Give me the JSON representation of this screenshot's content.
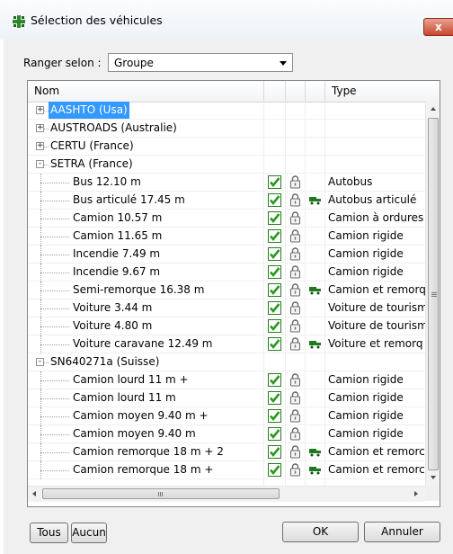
{
  "window": {
    "title": "Sélection des véhicules",
    "close_glyph": "x"
  },
  "sort": {
    "label": "Ranger selon :",
    "value": "Groupe"
  },
  "columns": {
    "name": "Nom",
    "type": "Type"
  },
  "rows": [
    {
      "level": 0,
      "expander": "+",
      "name": "AASHTO (Usa)",
      "selected": true
    },
    {
      "level": 0,
      "expander": "+",
      "name": "AUSTROADS (Australie)"
    },
    {
      "level": 0,
      "expander": "+",
      "name": "CERTU (France)"
    },
    {
      "level": 0,
      "expander": "-",
      "name": "SETRA (France)"
    },
    {
      "level": 1,
      "name": "Bus 12.10 m",
      "check": true,
      "lock": true,
      "trailer": false,
      "type": "Autobus"
    },
    {
      "level": 1,
      "name": "Bus articulé 17.45 m",
      "check": true,
      "lock": true,
      "trailer": true,
      "type": "Autobus articulé"
    },
    {
      "level": 1,
      "name": "Camion 10.57 m",
      "check": true,
      "lock": true,
      "trailer": false,
      "type": "Camion à ordures"
    },
    {
      "level": 1,
      "name": "Camion 11.65 m",
      "check": true,
      "lock": true,
      "trailer": false,
      "type": "Camion rigide"
    },
    {
      "level": 1,
      "name": "Incendie 7.49 m",
      "check": true,
      "lock": true,
      "trailer": false,
      "type": "Camion rigide"
    },
    {
      "level": 1,
      "name": "Incendie 9.67 m",
      "check": true,
      "lock": true,
      "trailer": false,
      "type": "Camion rigide"
    },
    {
      "level": 1,
      "name": "Semi-remorque 16.38 m",
      "check": true,
      "lock": true,
      "trailer": true,
      "type": "Camion et remorq"
    },
    {
      "level": 1,
      "name": "Voiture 3.44 m",
      "check": true,
      "lock": true,
      "trailer": false,
      "type": "Voiture de tourism"
    },
    {
      "level": 1,
      "name": "Voiture 4.80 m",
      "check": true,
      "lock": true,
      "trailer": false,
      "type": "Voiture de tourism"
    },
    {
      "level": 1,
      "name": "Voiture caravane 12.49 m",
      "check": true,
      "lock": true,
      "trailer": true,
      "type": "Voiture et remorq"
    },
    {
      "level": 0,
      "expander": "-",
      "name": "SN640271a (Suisse)"
    },
    {
      "level": 1,
      "name": "Camion lourd 11 m +",
      "check": true,
      "lock": true,
      "trailer": false,
      "type": "Camion rigide"
    },
    {
      "level": 1,
      "name": "Camion lourd 11 m",
      "check": true,
      "lock": true,
      "trailer": false,
      "type": "Camion rigide"
    },
    {
      "level": 1,
      "name": "Camion moyen 9.40 m +",
      "check": true,
      "lock": true,
      "trailer": false,
      "type": "Camion rigide"
    },
    {
      "level": 1,
      "name": "Camion moyen 9.40 m",
      "check": true,
      "lock": true,
      "trailer": false,
      "type": "Camion rigide"
    },
    {
      "level": 1,
      "name": "Camion remorque 18 m + 2",
      "check": true,
      "lock": true,
      "trailer": true,
      "type": "Camion et remorc"
    },
    {
      "level": 1,
      "name": "Camion remorque 18 m +",
      "check": true,
      "lock": true,
      "trailer": true,
      "type": "Camion et remorc"
    }
  ],
  "scrollbar": {
    "h_grip": "III"
  },
  "buttons": {
    "all": "Tous",
    "none": "Aucun",
    "ok": "OK",
    "cancel": "Annuler"
  },
  "colors": {
    "selection": "#3399ff",
    "check_green": "#2a9a1e",
    "trailer_green": "#1f7a1f",
    "close_red": "#c9452b"
  },
  "icons": {
    "window": "vehicle-grid-icon",
    "check": "checkbox-checked-icon",
    "lock": "padlock-icon",
    "trailer": "trailer-icon",
    "expander_plus": "plus-box-icon",
    "expander_minus": "minus-box-icon"
  }
}
